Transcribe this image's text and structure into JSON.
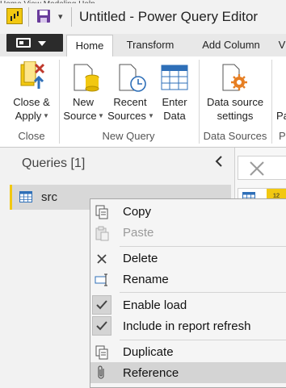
{
  "window": {
    "title": "Untitled - Power Query Editor",
    "top_menu_partial": "Home    View    Modeling    Help"
  },
  "quick_access": {
    "dropdown_glyph": "▾"
  },
  "tabs": [
    {
      "label": "Home",
      "active": true
    },
    {
      "label": "Transform"
    },
    {
      "label": "Add Column"
    },
    {
      "label": "V"
    }
  ],
  "ribbon": {
    "close_apply": {
      "line1": "Close &",
      "line2": "Apply"
    },
    "new_source": {
      "line1": "New",
      "line2": "Source"
    },
    "recent_sources": {
      "line1": "Recent",
      "line2": "Sources"
    },
    "enter_data": {
      "line1": "Enter",
      "line2": "Data"
    },
    "data_source_settings": {
      "line1": "Data source",
      "line2": "settings"
    },
    "cut_off_label": "Pa",
    "groups": {
      "close": "Close",
      "new_query": "New Query",
      "data_sources": "Data Sources",
      "cut_off": "P"
    }
  },
  "queries": {
    "title": "Queries [1]",
    "items": [
      {
        "label": "src"
      }
    ]
  },
  "grid": {
    "type_glyph": "¹²"
  },
  "context_menu": {
    "copy": "Copy",
    "paste": "Paste",
    "delete": "Delete",
    "rename": "Rename",
    "enable_load": "Enable load",
    "include_refresh": "Include in report refresh",
    "duplicate": "Duplicate",
    "reference": "Reference"
  },
  "colors": {
    "accent": "#f2c811",
    "selected_bg": "#d8d8d8",
    "file_tab": "#2b2b2b",
    "delete_red": "#c0392b"
  }
}
